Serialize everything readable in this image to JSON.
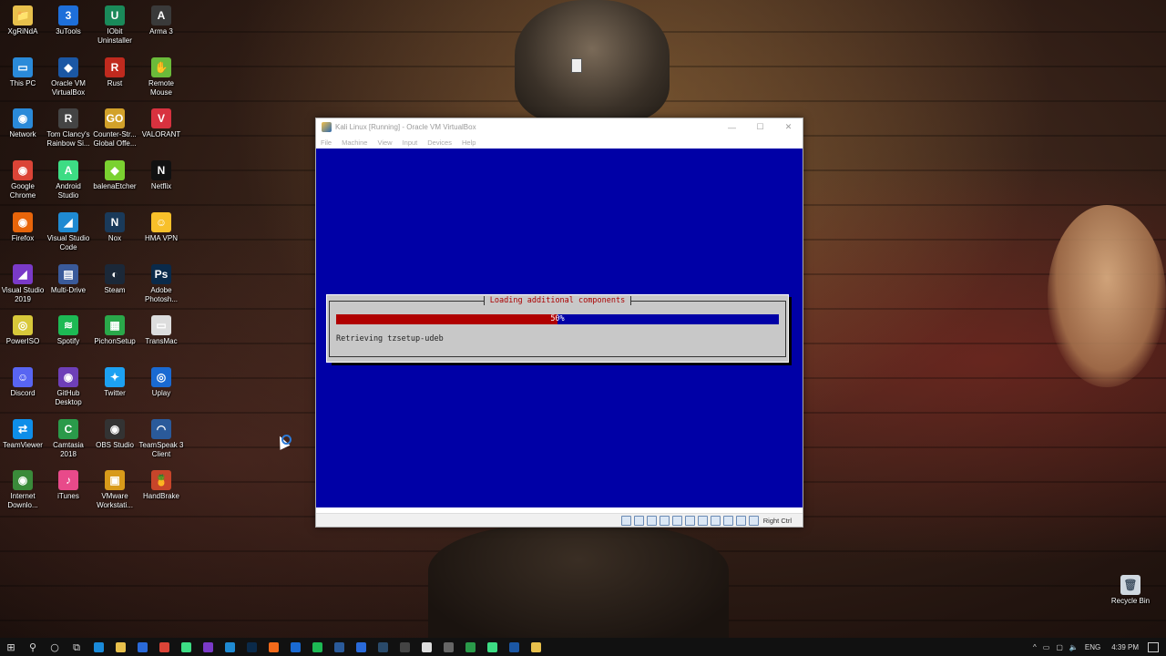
{
  "desktop": {
    "icons": [
      {
        "label": "XgRiNdA",
        "icon": "folder-user-icon",
        "color": "#e8c04c",
        "glyph": "📁"
      },
      {
        "label": "3uTools",
        "icon": "3utools-icon",
        "color": "#1e6fd9",
        "glyph": "3"
      },
      {
        "label": "IObit Uninstaller",
        "icon": "iobit-icon",
        "color": "#1a8a5a",
        "glyph": "U"
      },
      {
        "label": "Arma 3",
        "icon": "arma3-icon",
        "color": "#3a3a3a",
        "glyph": "A"
      },
      {
        "label": "This PC",
        "icon": "this-pc-icon",
        "color": "#2a8ad9",
        "glyph": "▭"
      },
      {
        "label": "Oracle VM VirtualBox",
        "icon": "virtualbox-icon",
        "color": "#1b57a4",
        "glyph": "◆"
      },
      {
        "label": "Rust",
        "icon": "rust-icon",
        "color": "#c02a1e",
        "glyph": "R"
      },
      {
        "label": "Remote Mouse",
        "icon": "remote-mouse-icon",
        "color": "#6bbb3a",
        "glyph": "✋"
      },
      {
        "label": "Network",
        "icon": "network-icon",
        "color": "#2a8ad9",
        "glyph": "◉"
      },
      {
        "label": "Tom Clancy's Rainbow Si...",
        "icon": "rainbow-six-icon",
        "color": "#444",
        "glyph": "R"
      },
      {
        "label": "Counter-Str... Global Offe...",
        "icon": "csgo-icon",
        "color": "#d2a12a",
        "glyph": "GO"
      },
      {
        "label": "VALORANT",
        "icon": "valorant-icon",
        "color": "#d8323f",
        "glyph": "V"
      },
      {
        "label": "Google Chrome",
        "icon": "chrome-icon",
        "color": "#db4437",
        "glyph": "◉"
      },
      {
        "label": "Android Studio",
        "icon": "android-studio-icon",
        "color": "#3ddc84",
        "glyph": "A"
      },
      {
        "label": "balenaEtcher",
        "icon": "balena-etcher-icon",
        "color": "#7ad130",
        "glyph": "◆"
      },
      {
        "label": "Netflix",
        "icon": "netflix-icon",
        "color": "#111",
        "glyph": "N"
      },
      {
        "label": "Firefox",
        "icon": "firefox-icon",
        "color": "#e8650a",
        "glyph": "◉"
      },
      {
        "label": "Visual Studio Code",
        "icon": "vscode-icon",
        "color": "#1f8ad2",
        "glyph": "◢"
      },
      {
        "label": "Nox",
        "icon": "nox-icon",
        "color": "#1a3a5a",
        "glyph": "N"
      },
      {
        "label": "HMA VPN",
        "icon": "hma-vpn-icon",
        "color": "#f8c02a",
        "glyph": "☺"
      },
      {
        "label": "Visual Studio 2019",
        "icon": "visual-studio-icon",
        "color": "#7a3ac8",
        "glyph": "◢"
      },
      {
        "label": "Multi-Drive",
        "icon": "multi-drive-icon",
        "color": "#3a5a9a",
        "glyph": "▤"
      },
      {
        "label": "Steam",
        "icon": "steam-icon",
        "color": "#1b2838",
        "glyph": "◐"
      },
      {
        "label": "Adobe Photosh...",
        "icon": "photoshop-icon",
        "color": "#0a2a4a",
        "glyph": "Ps"
      },
      {
        "label": "PowerISO",
        "icon": "poweriso-icon",
        "color": "#d8c83a",
        "glyph": "◎"
      },
      {
        "label": "Spotify",
        "icon": "spotify-icon",
        "color": "#1db954",
        "glyph": "≋"
      },
      {
        "label": "PichonSetup",
        "icon": "pichon-icon",
        "color": "#2aa84a",
        "glyph": "▦"
      },
      {
        "label": "TransMac",
        "icon": "transmac-icon",
        "color": "#ddd",
        "glyph": "▭"
      },
      {
        "label": "Discord",
        "icon": "discord-icon",
        "color": "#5865f2",
        "glyph": "☺"
      },
      {
        "label": "GitHub Desktop",
        "icon": "github-desktop-icon",
        "color": "#6e3fb8",
        "glyph": "◉"
      },
      {
        "label": "Twitter",
        "icon": "twitter-icon",
        "color": "#1da1f2",
        "glyph": "✦"
      },
      {
        "label": "Uplay",
        "icon": "uplay-icon",
        "color": "#1a6ad2",
        "glyph": "◎"
      },
      {
        "label": "TeamViewer",
        "icon": "teamviewer-icon",
        "color": "#0e8ee9",
        "glyph": "⇄"
      },
      {
        "label": "Camtasia 2018",
        "icon": "camtasia-icon",
        "color": "#2a9a4a",
        "glyph": "C"
      },
      {
        "label": "OBS Studio",
        "icon": "obs-icon",
        "color": "#333",
        "glyph": "◉"
      },
      {
        "label": "TeamSpeak 3 Client",
        "icon": "teamspeak-icon",
        "color": "#2a5a9a",
        "glyph": "◠"
      },
      {
        "label": "Internet Downlo...",
        "icon": "idm-icon",
        "color": "#3a8a3a",
        "glyph": "◉"
      },
      {
        "label": "iTunes",
        "icon": "itunes-icon",
        "color": "#e84a8a",
        "glyph": "♪"
      },
      {
        "label": "VMware Workstati...",
        "icon": "vmware-icon",
        "color": "#d89a1a",
        "glyph": "▣"
      },
      {
        "label": "HandBrake",
        "icon": "handbrake-icon",
        "color": "#c8452a",
        "glyph": "🍍"
      }
    ],
    "recycle_bin": {
      "label": "Recycle Bin",
      "icon": "recycle-bin-icon"
    }
  },
  "vbox": {
    "title": "Kali Linux [Running] - Oracle VM VirtualBox",
    "controls": {
      "minimize": "—",
      "maximize": "☐",
      "close": "✕"
    },
    "menu": [
      "File",
      "Machine",
      "View",
      "Input",
      "Devices",
      "Help"
    ],
    "host_key": "Right Ctrl",
    "status_icons": [
      "hard-disk-icon",
      "optical-drive-icon",
      "audio-icon",
      "network-adapter-icon",
      "usb-icon",
      "shared-folder-icon",
      "display-icon",
      "video-capture-icon",
      "cpu-icon",
      "mouse-integration-icon",
      "arrow-down-icon"
    ]
  },
  "installer": {
    "dialog_title": "Loading additional components",
    "progress_text": "50%",
    "progress_fraction": 0.5,
    "message": "Retrieving tzsetup-udeb"
  },
  "taskbar": {
    "start": "⊞",
    "search": "⚲",
    "cortana": "○",
    "task_view": "⧉",
    "apps": [
      {
        "name": "edge-icon",
        "color": "#1a8ad9"
      },
      {
        "name": "file-explorer-icon",
        "color": "#e8c04c"
      },
      {
        "name": "store-icon",
        "color": "#2a6ad9"
      },
      {
        "name": "chrome-icon",
        "color": "#db4437"
      },
      {
        "name": "android-studio-icon",
        "color": "#3ddc84"
      },
      {
        "name": "visual-studio-icon",
        "color": "#7a3ac8"
      },
      {
        "name": "vscode-icon",
        "color": "#1f8ad2"
      },
      {
        "name": "photoshop-icon",
        "color": "#0a2a4a"
      },
      {
        "name": "origin-icon",
        "color": "#f46a1a"
      },
      {
        "name": "uplay-icon",
        "color": "#1a6ad2"
      },
      {
        "name": "spotify-icon",
        "color": "#1db954"
      },
      {
        "name": "teamviewer-icon",
        "color": "#2a5a9a"
      },
      {
        "name": "mail-icon",
        "color": "#2a6ad9"
      },
      {
        "name": "steam-icon",
        "color": "#2a4a6a"
      },
      {
        "name": "obs-icon",
        "color": "#444"
      },
      {
        "name": "edit-icon",
        "color": "#ddd"
      },
      {
        "name": "usb-drive-icon",
        "color": "#666"
      },
      {
        "name": "camtasia-icon",
        "color": "#2a9a4a"
      },
      {
        "name": "android-icon",
        "color": "#3ddc84"
      },
      {
        "name": "virtualbox-icon",
        "color": "#1b57a4"
      },
      {
        "name": "folder-icon",
        "color": "#e8c04c"
      }
    ],
    "tray": {
      "chevron": "^",
      "language": "ENG",
      "time": "4:39 PM"
    }
  }
}
